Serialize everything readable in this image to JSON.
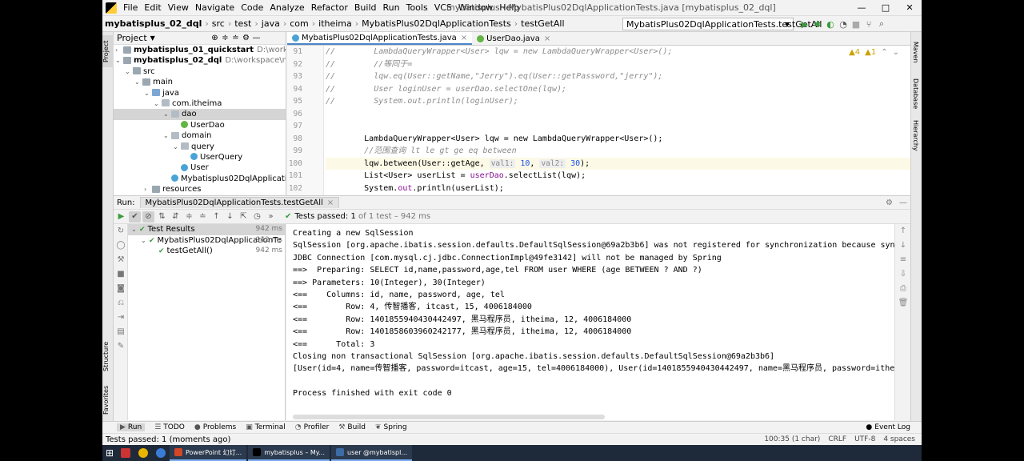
{
  "menu": {
    "items": [
      "File",
      "Edit",
      "View",
      "Navigate",
      "Code",
      "Analyze",
      "Refactor",
      "Build",
      "Run",
      "Tools",
      "VCS",
      "Window",
      "Help"
    ],
    "window_title": "mybatisplus - MybatisPlus02DqlApplicationTests.java [mybatisplus_02_dql]",
    "controls": [
      "—",
      "□",
      "✕"
    ]
  },
  "breadcrumb": {
    "items": [
      "mybatisplus_02_dql",
      "src",
      "test",
      "java",
      "com",
      "itheima",
      "MybatisPlus02DqlApplicationTests",
      "testGetAll"
    ],
    "run_config": "MybatisPlus02DqlApplicationTests.testGetAll"
  },
  "left_strip": [
    "Project",
    "Structure",
    "Favorites"
  ],
  "right_strip": [
    "Maven",
    "Database",
    "Hierarchy"
  ],
  "project": {
    "title": "Project",
    "tree": [
      {
        "label": "mybatisplus_01_quickstart",
        "path": "D:\\workspace\\m",
        "indent": 0,
        "arrow": "›",
        "icon": "folder",
        "bold": true
      },
      {
        "label": "mybatisplus_02_dql",
        "path": "D:\\workspace\\mybatisp",
        "indent": 0,
        "arrow": "⌄",
        "icon": "folder",
        "bold": true
      },
      {
        "label": "src",
        "path": "",
        "indent": 1,
        "arrow": "⌄",
        "icon": "folder"
      },
      {
        "label": "main",
        "path": "",
        "indent": 2,
        "arrow": "⌄",
        "icon": "folder"
      },
      {
        "label": "java",
        "path": "",
        "indent": 3,
        "arrow": "⌄",
        "icon": "folderblue"
      },
      {
        "label": "com.itheima",
        "path": "",
        "indent": 4,
        "arrow": "⌄",
        "icon": "pkg"
      },
      {
        "label": "dao",
        "path": "",
        "indent": 5,
        "arrow": "⌄",
        "icon": "pkg",
        "selected": true
      },
      {
        "label": "UserDao",
        "path": "",
        "indent": 6,
        "arrow": "",
        "icon": "cls2"
      },
      {
        "label": "domain",
        "path": "",
        "indent": 5,
        "arrow": "⌄",
        "icon": "pkg"
      },
      {
        "label": "query",
        "path": "",
        "indent": 6,
        "arrow": "⌄",
        "icon": "pkg"
      },
      {
        "label": "UserQuery",
        "path": "",
        "indent": 7,
        "arrow": "",
        "icon": "cls"
      },
      {
        "label": "User",
        "path": "",
        "indent": 6,
        "arrow": "",
        "icon": "cls"
      },
      {
        "label": "Mybatisplus02DqlApplication",
        "path": "",
        "indent": 5,
        "arrow": "",
        "icon": "cls"
      },
      {
        "label": "resources",
        "path": "",
        "indent": 3,
        "arrow": "›",
        "icon": "folder"
      }
    ]
  },
  "editor": {
    "tabs": [
      {
        "label": "MybatisPlus02DqlApplicationTests.java",
        "active": true
      },
      {
        "label": "UserDao.java",
        "active": false
      }
    ],
    "warnings": "▲4",
    "weak_warnings": "▲1",
    "lines": [
      {
        "n": "91",
        "html": "<span class=\"cm\">//        LambdaQueryWrapper&lt;User&gt; lqw = new LambdaQueryWrapper&lt;User&gt;();</span>"
      },
      {
        "n": "92",
        "html": "<span class=\"cm\">//        //等同于=</span>"
      },
      {
        "n": "93",
        "html": "<span class=\"cm\">//        lqw.eq(User::getName,\"Jerry\").eq(User::getPassword,\"jerry\");</span>"
      },
      {
        "n": "94",
        "html": "<span class=\"cm\">//        User loginUser = userDao.selectOne(lqw);</span>"
      },
      {
        "n": "95",
        "html": "<span class=\"cm\">//        System.out.println(loginUser);</span>"
      },
      {
        "n": "96",
        "html": ""
      },
      {
        "n": "97",
        "html": ""
      },
      {
        "n": "98",
        "html": "        LambdaQueryWrapper&lt;User&gt; lqw = new LambdaQueryWrapper&lt;User&gt;();"
      },
      {
        "n": "99",
        "html": "        <span class=\"cm\">//范围查询 lt le gt ge eq between</span>"
      },
      {
        "n": "100",
        "html": "        lqw.between(User::getAge, <span class=\"hint\">val1:</span> <span class=\"num\">10</span>, <span class=\"hint\">val2:</span> <span class=\"num\">30</span>);",
        "hl": true
      },
      {
        "n": "101",
        "html": "        List&lt;User&gt; userList = <span class=\"call\">userDao</span>.selectList(lqw);"
      },
      {
        "n": "102",
        "html": "        System.<span class=\"call\">out</span>.println(userList);"
      }
    ]
  },
  "run": {
    "label": "Run:",
    "tab": "MybatisPlus02DqlApplicationTests.testGetAll",
    "status_prefix": "Tests passed:",
    "status_count": "1",
    "status_suffix": "of 1 test – 942 ms",
    "tree": [
      {
        "label": "Test Results",
        "ms": "942 ms",
        "indent": 0,
        "arrow": "⌄",
        "selected": true
      },
      {
        "label": "MybatisPlus02DqlApplicationTe",
        "ms": "942 ms",
        "indent": 1,
        "arrow": "⌄"
      },
      {
        "label": "testGetAll()",
        "ms": "942 ms",
        "indent": 2,
        "arrow": ""
      }
    ],
    "console": [
      "Creating a new SqlSession",
      "SqlSession [org.apache.ibatis.session.defaults.DefaultSqlSession@69a2b3b6] was not registered for synchronization because synchr",
      "JDBC Connection [com.mysql.cj.jdbc.ConnectionImpl@49fe3142] will not be managed by Spring",
      "==>  Preparing: SELECT id,name,password,age,tel FROM user WHERE (age BETWEEN ? AND ?)",
      "==> Parameters: 10(Integer), 30(Integer)",
      "<==    Columns: id, name, password, age, tel",
      "<==        Row: 4, 传智播客, itcast, 15, 4006184000",
      "<==        Row: 1401855940430442497, 黑马程序员, itheima, 12, 4006184000",
      "<==        Row: 1401858603960242177, 黑马程序员, itheima, 12, 4006184000",
      "<==      Total: 3",
      "Closing non transactional SqlSession [org.apache.ibatis.session.defaults.DefaultSqlSession@69a2b3b6]",
      "[User(id=4, name=传智播客, password=itcast, age=15, tel=4006184000), User(id=1401855940430442497, name=黑马程序员, password=itheim",
      "",
      "Process finished with exit code 0"
    ]
  },
  "bottom_tabs": [
    {
      "label": "Run",
      "icon": "▶"
    },
    {
      "label": "TODO",
      "icon": "☰"
    },
    {
      "label": "Problems",
      "icon": "●"
    },
    {
      "label": "Terminal",
      "icon": "▣"
    },
    {
      "label": "Profiler",
      "icon": "◔"
    },
    {
      "label": "Build",
      "icon": "⚒"
    },
    {
      "label": "Spring",
      "icon": "❦"
    }
  ],
  "event_log": "Event Log",
  "status": {
    "message": "Tests passed: 1 (moments ago)",
    "position": "100:35 (1 char)",
    "line_sep": "CRLF",
    "encoding": "UTF-8",
    "indent": "4 spaces"
  },
  "taskbar": {
    "tasks": [
      {
        "label": "PowerPoint 幻灯...",
        "color": "#d24726"
      },
      {
        "label": "mybatisplus – My...",
        "color": "#000000"
      },
      {
        "label": "user @mybatispl...",
        "color": "#3d6ba6"
      }
    ]
  }
}
